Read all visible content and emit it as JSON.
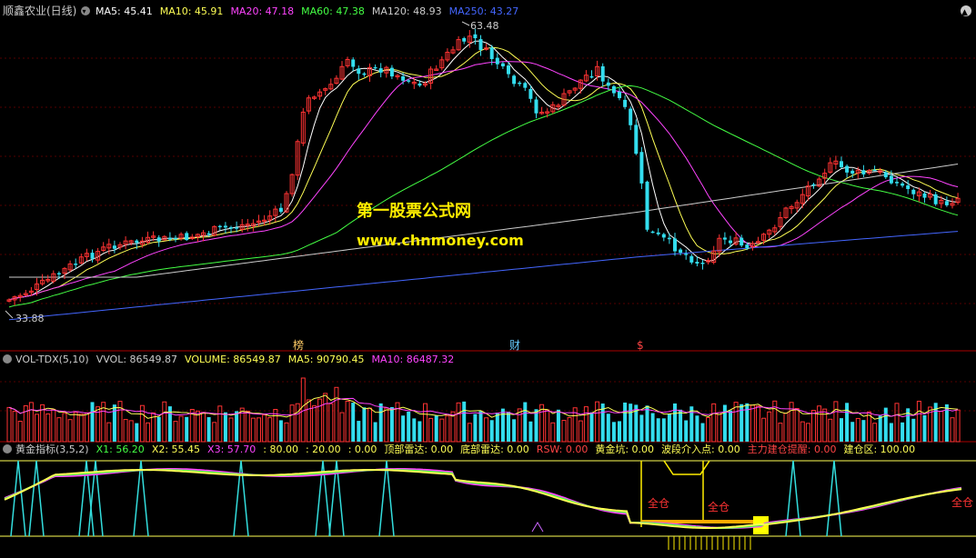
{
  "header": {
    "title": "顺鑫农业(日线)",
    "items": [
      {
        "label": "MA5: 45.41",
        "color": "#ffffff"
      },
      {
        "label": "MA10: 45.91",
        "color": "#ffff55"
      },
      {
        "label": "MA20: 47.18",
        "color": "#ff44ff"
      },
      {
        "label": "MA60: 47.38",
        "color": "#44ff44"
      },
      {
        "label": "MA120: 48.93",
        "color": "#cccccc"
      },
      {
        "label": "MA250: 43.27",
        "color": "#4466ff"
      }
    ]
  },
  "price_panel": {
    "high_label": "63.48",
    "low_label": "33.88",
    "markers": [
      {
        "text": "榜",
        "color": "#ffcc66"
      },
      {
        "text": "财",
        "color": "#66ccff"
      },
      {
        "text": "$",
        "color": "#ff4444"
      }
    ],
    "watermark": {
      "line1": "第一股票公式网",
      "line2": "www.chnmoney.com"
    }
  },
  "volume_panel": {
    "items": [
      {
        "label": "VOL-TDX(5,10)",
        "color": "#cccccc"
      },
      {
        "label": "VVOL: 86549.87",
        "color": "#cccccc"
      },
      {
        "label": "VOLUME: 86549.87",
        "color": "#ffff55"
      },
      {
        "label": "MA5: 90790.45",
        "color": "#ffff55"
      },
      {
        "label": "MA10: 86487.32",
        "color": "#ff44ff"
      }
    ]
  },
  "indicator_panel": {
    "items": [
      {
        "label": "黄金指标(3,5,2)",
        "color": "#cccccc"
      },
      {
        "label": "X1: 56.20",
        "color": "#44ff44"
      },
      {
        "label": "X2: 55.45",
        "color": "#ffff55"
      },
      {
        "label": "X3: 57.70",
        "color": "#ff44ff"
      },
      {
        "label": ": 80.00",
        "color": "#ffff55"
      },
      {
        "label": ": 20.00",
        "color": "#ffff55"
      },
      {
        "label": ": 0.00",
        "color": "#ffff55"
      },
      {
        "label": "顶部雷达: 0.00",
        "color": "#ffff55"
      },
      {
        "label": "底部雷达: 0.00",
        "color": "#ffff55"
      },
      {
        "label": "RSW: 0.00",
        "color": "#ff4444"
      },
      {
        "label": "黄金坑: 0.00",
        "color": "#ffff55"
      },
      {
        "label": "波段介入点: 0.00",
        "color": "#ffff55"
      },
      {
        "label": "主力建仓提醒: 0.00",
        "color": "#ff4444"
      },
      {
        "label": "建仓区: 100.00",
        "color": "#ffff55"
      }
    ],
    "labels": {
      "full1": "全仓",
      "full2": "全仓",
      "full3": "全仓"
    }
  },
  "chart_data": [
    {
      "type": "candlestick",
      "title": "顺鑫农业(日线)",
      "ylim": [
        33.88,
        63.48
      ],
      "annotations": {
        "max": 63.48,
        "min": 33.88
      },
      "moving_averages": [
        {
          "name": "MA5",
          "last": 45.41,
          "color": "#ffffff"
        },
        {
          "name": "MA10",
          "last": 45.91,
          "color": "#ffff55"
        },
        {
          "name": "MA20",
          "last": 47.18,
          "color": "#ff44ff"
        },
        {
          "name": "MA60",
          "last": 47.38,
          "color": "#44ff44"
        },
        {
          "name": "MA120",
          "last": 48.93,
          "color": "#cccccc"
        },
        {
          "name": "MA250",
          "last": 43.27,
          "color": "#4466ff"
        }
      ]
    },
    {
      "type": "bar",
      "title": "VOL-TDX(5,10)",
      "last_volume": 86549.87,
      "ma5": 90790.45,
      "ma10": 86487.32
    },
    {
      "type": "line",
      "title": "黄金指标(3,5,2)",
      "series": [
        {
          "name": "X1",
          "last": 56.2,
          "color": "#44ff44"
        },
        {
          "name": "X2",
          "last": 55.45,
          "color": "#ffff55"
        },
        {
          "name": "X3",
          "last": 57.7,
          "color": "#ff44ff"
        }
      ],
      "reference_lines": [
        80,
        20,
        0
      ],
      "signals": {
        "顶部雷达": 0,
        "底部雷达": 0,
        "RSW": 0,
        "黄金坑": 0,
        "波段介入点": 0,
        "主力建仓提醒": 0,
        "建仓区": 100
      }
    }
  ]
}
